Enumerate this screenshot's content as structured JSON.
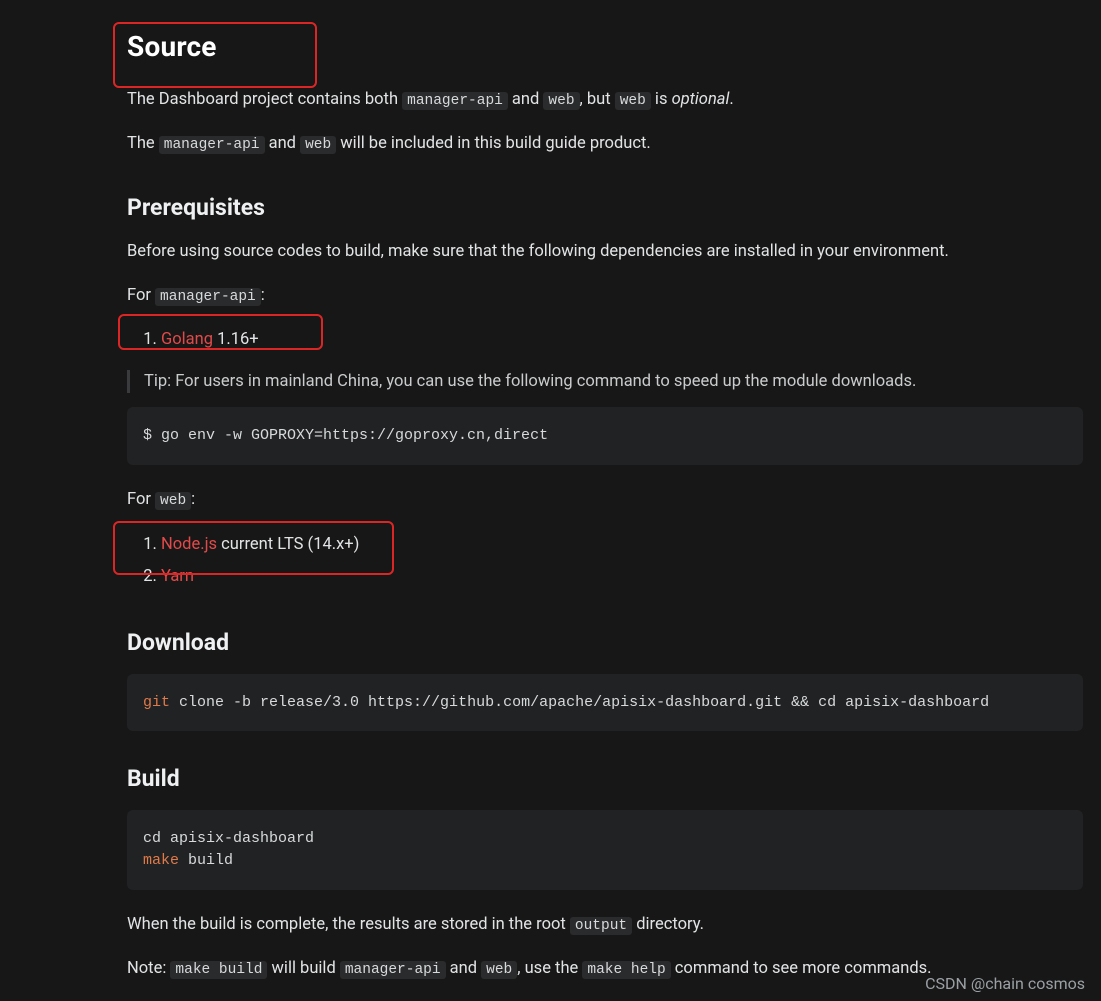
{
  "heading_source": "Source",
  "para1_pre": "The Dashboard project contains both ",
  "para1_c1": "manager-api",
  "para1_mid1": " and ",
  "para1_c2": "web",
  "para1_mid2": ", but ",
  "para1_c3": "web",
  "para1_mid3": " is ",
  "para1_em": "optional",
  "para1_end": ".",
  "para2_pre": "The ",
  "para2_c1": "manager-api",
  "para2_mid1": " and ",
  "para2_c2": "web",
  "para2_end": " will be included in this build guide product.",
  "heading_prereq": "Prerequisites",
  "prereq_intro": "Before using source codes to build, make sure that the following dependencies are installed in your environment.",
  "for_api_pre": "For ",
  "for_api_code": "manager-api",
  "for_api_end": ":",
  "api_dep1_link": "Golang",
  "api_dep1_rest": " 1.16+",
  "tip_text": "Tip: For users in mainland China, you can use the following command to speed up the module downloads.",
  "code_goproxy": "$ go env -w GOPROXY=https://goproxy.cn,direct",
  "for_web_pre": "For ",
  "for_web_code": "web",
  "for_web_end": ":",
  "web_dep1_link": "Node.js",
  "web_dep1_rest": " current LTS (14.x+)",
  "web_dep2_link": "Yarn",
  "heading_download": "Download",
  "code_git_kw": "git",
  "code_git_rest": " clone -b release/3.0 https://github.com/apache/apisix-dashboard.git && cd apisix-dashboard",
  "heading_build": "Build",
  "code_build_line1": "cd apisix-dashboard",
  "code_build_kw": "make",
  "code_build_rest": " build",
  "build_done_pre": "When the build is complete, the results are stored in the root ",
  "build_done_code": "output",
  "build_done_end": " directory.",
  "note_pre": "Note: ",
  "note_c1": "make build",
  "note_mid1": " will build ",
  "note_c2": "manager-api",
  "note_mid2": " and ",
  "note_c3": "web",
  "note_mid3": ", use the ",
  "note_c4": "make help",
  "note_end": " command to see more commands.",
  "watermark": "CSDN @chain cosmos"
}
